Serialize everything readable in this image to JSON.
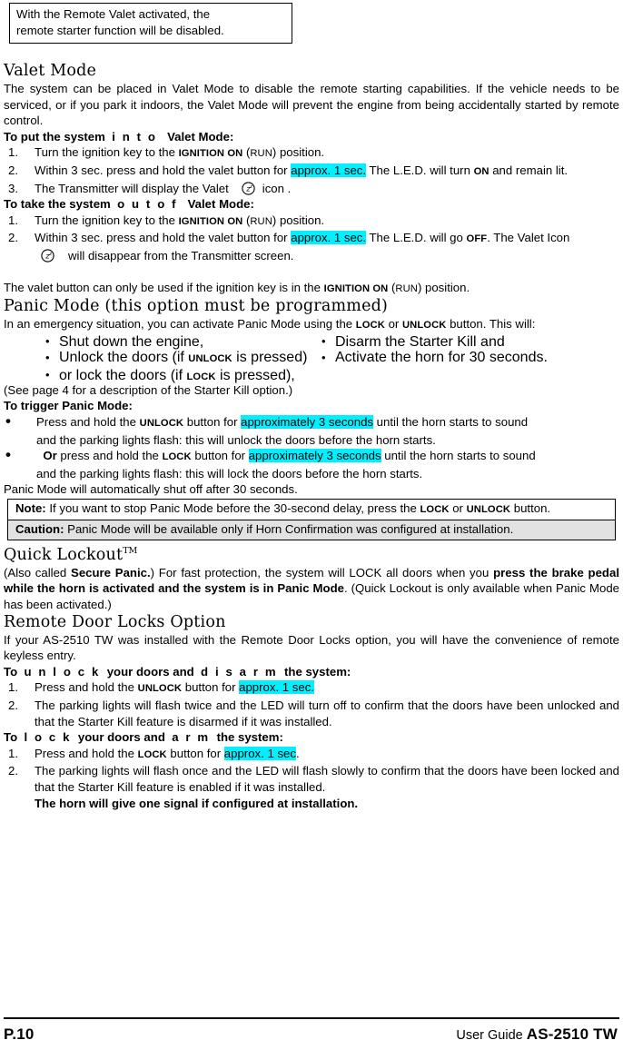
{
  "callout": {
    "line1": "With the Remote Valet activated, the",
    "line2": "remote starter function will be disabled."
  },
  "valet_mode": {
    "heading": "Valet Mode",
    "intro": "The system can be placed in Valet Mode to disable the remote starting capabilities. If the vehicle needs to be serviced, or if you park it indoors, the Valet Mode will prevent the engine from being accidentally started by remote control.",
    "into_head_pre": "To put the system",
    "into_head_spaced": "i n t o",
    "into_head_post": "Valet Mode:",
    "into_steps": [
      {
        "num": "1.",
        "pre": "Turn the ignition key to the ",
        "sc1": "IGNITION ON",
        "mid": " (",
        "sc2": "RUN",
        "post": ") position."
      },
      {
        "num": "2.",
        "pre": "Within 3 sec. press and hold the valet button for ",
        "highlight": "approx. 1 sec.",
        "mid": " The L.E.D. will turn ",
        "sc1": "ON",
        "post": " and remain lit."
      },
      {
        "num": "3.",
        "pre": "The Transmitter will display the Valet",
        "post": "icon   ."
      }
    ],
    "outof_head_pre": "To take the system",
    "outof_head_spaced": "o u t    o f",
    "outof_head_post": "Valet Mode:",
    "outof_steps": [
      {
        "num": "1.",
        "pre": "Turn the ignition key to the ",
        "sc1": "IGNITION ON",
        "mid": " (",
        "sc2": "RUN",
        "post": ") position."
      },
      {
        "num": "2.",
        "pre": "Within 3 sec. press and hold the valet button for ",
        "highlight": "approx. 1 sec.",
        "mid": " The L.E.D. will go ",
        "sc1": "OFF",
        "post": ".    The Valet Icon",
        "tail": "will disappear from the Transmitter screen."
      }
    ],
    "valet_note_pre": "The valet button can only be used if the ignition key is in the ",
    "valet_note_sc1": "IGNITION ON",
    "valet_note_mid": " (",
    "valet_note_sc2": "RUN",
    "valet_note_post": ") position."
  },
  "panic_mode": {
    "heading": "Panic Mode (this option must be programmed)",
    "intro_pre": "In an emergency situation, you can activate Panic Mode using the ",
    "intro_sc1": "LOCK",
    "intro_mid": " or ",
    "intro_sc2": "UNLOCK",
    "intro_post": " button. This will:",
    "bullets_left": [
      {
        "pre": "Shut down the engine,",
        "sc": "",
        "post": ""
      },
      {
        "pre": "Unlock the doors (if ",
        "sc": "UNLOCK",
        "post": " is pressed)"
      },
      {
        "pre": "or lock the doors (if ",
        "sc": "LOCK",
        "post": " is pressed),"
      }
    ],
    "bullets_right": [
      {
        "pre": "Disarm the Starter Kill and",
        "sc": "",
        "post": ""
      },
      {
        "pre": "Activate the horn for 30 seconds.",
        "sc": "",
        "post": ""
      }
    ],
    "see_page": "(See page 4 for a description of the Starter Kill option.)",
    "trigger_head": "To trigger Panic Mode:",
    "trigger_items": [
      {
        "lead": "",
        "pre": "Press and hold the ",
        "sc": "UNLOCK",
        "mid": " button for ",
        "highlight": "approximately 3 seconds",
        "post": "  until the horn starts to sound",
        "line2": "and the parking lights flash: this will unlock the doors before the horn starts."
      },
      {
        "lead": "Or",
        "pre": " press and hold the ",
        "sc": "LOCK",
        "mid": " button for ",
        "highlight": "approximately 3 seconds",
        "post": " until the horn starts to sound",
        "line2": "and the parking lights flash: this will lock the doors before the horn starts."
      }
    ],
    "shutoff": "Panic Mode will automatically shut off after 30 seconds.",
    "note_label": "Note:",
    "note_pre": " If you want to stop Panic Mode before the 30-second delay, press the ",
    "note_sc1": "LOCK",
    "note_mid": " or ",
    "note_sc2": "UNLOCK",
    "note_post": " button.",
    "caution_label": "Caution:",
    "caution_text": " Panic Mode will be available only if Horn Confirmation was configured at installation."
  },
  "quick_lockout": {
    "heading": "Quick Lockout",
    "heading_sup": "TM",
    "p_pre": "(Also called ",
    "p_b1": "Secure Panic.",
    "p_mid": ") For fast protection, the system will LOCK all doors when you ",
    "p_b2": "press the brake pedal while the horn is activated and the system is in Panic Mode",
    "p_post": ". (Quick Lockout is only available when Panic Mode has been activated.)"
  },
  "remote_door_locks": {
    "heading": "Remote Door Locks Option",
    "intro": "If your AS-2510 TW was installed with the Remote Door Locks option, you will have the convenience of remote keyless entry.",
    "unlock_head_pre": "To",
    "unlock_head_sp1": "u n l o c k",
    "unlock_head_mid": "your doors and",
    "unlock_head_sp2": "d i s a r m",
    "unlock_head_post": "the system:",
    "unlock_steps": [
      {
        "num": "1.",
        "pre": "Press and hold the ",
        "sc": "UNLOCK",
        "mid": " button for ",
        "highlight": "approx. 1 sec.",
        "post": ""
      },
      {
        "num": "2.",
        "pre": "The parking lights will flash twice and the LED will turn off to confirm that the doors have been unlocked and that the Starter Kill feature is disarmed if it was installed.",
        "sc": "",
        "mid": "",
        "highlight": "",
        "post": ""
      }
    ],
    "lock_head_pre": "To",
    "lock_head_sp1": "l o c k",
    "lock_head_mid": "your doors and",
    "lock_head_sp2": "a r m",
    "lock_head_post": "the system:",
    "lock_steps": [
      {
        "num": "1.",
        "pre": "Press and hold the ",
        "sc": "LOCK",
        "mid": " button for ",
        "highlight": "approx. 1 sec",
        "post": "."
      },
      {
        "num": "2.",
        "pre": "The parking lights will flash once and the LED will flash slowly to confirm that the doors have been locked and that the Starter Kill feature is enabled if it was installed.",
        "sc": "",
        "mid": "",
        "highlight": "",
        "post": ""
      }
    ],
    "horn_note": "The horn will give one signal if configured at installation."
  },
  "footer": {
    "page": "P.10",
    "guide_label": "User Guide ",
    "model": "AS-2510 TW"
  },
  "colors": {
    "highlight": "#00F0FF",
    "caution_bg": "#E2E2E2",
    "text": "#000000"
  },
  "icons": {
    "valet": "valet-sleep-icon"
  }
}
